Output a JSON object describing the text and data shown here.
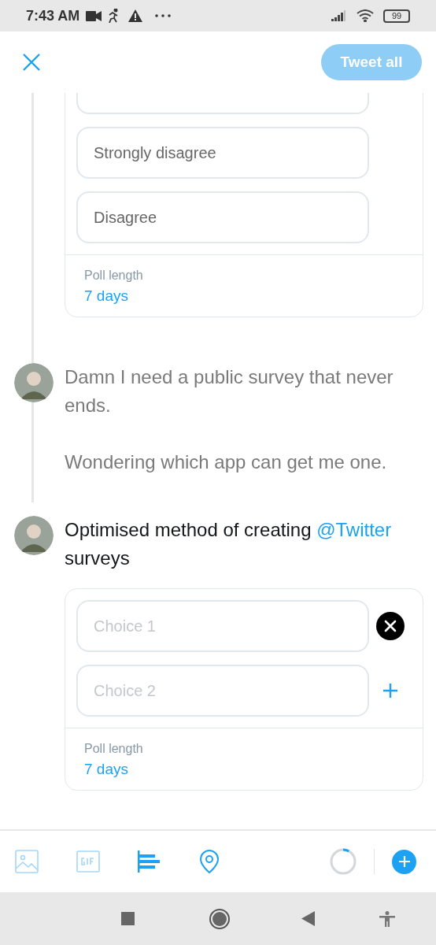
{
  "status_bar": {
    "time": "7:43 AM",
    "battery": "99"
  },
  "header": {
    "tweet_button": {
      "label": "Tweet all",
      "disabled": true
    }
  },
  "thread": [
    {
      "poll": {
        "choices": [
          {
            "kind": "clipped"
          },
          {
            "value": "Strongly disagree"
          },
          {
            "value": "Disagree"
          }
        ],
        "length_label": "Poll length",
        "length": "7 days"
      }
    },
    {
      "active": false,
      "paragraphs": [
        [
          {
            "text": "Damn I need a public survey that never ends."
          }
        ],
        [
          {
            "text": "Wondering which app can get me one."
          }
        ]
      ]
    },
    {
      "active": true,
      "paragraphs": [
        [
          {
            "text": "Optimised method of creating "
          },
          {
            "text": "@Twitter",
            "kind": "mention"
          },
          {
            "text": " surveys"
          }
        ]
      ],
      "poll": {
        "removable": true,
        "can_add_choice": true,
        "choices": [
          {
            "placeholder": "Choice 1"
          },
          {
            "placeholder": "Choice 2"
          }
        ],
        "length_label": "Poll length",
        "length": "7 days"
      }
    }
  ],
  "toolbar": {
    "items": [
      {
        "kind": "image",
        "disabled": true
      },
      {
        "kind": "gif",
        "disabled": true
      },
      {
        "kind": "poll",
        "disabled": false
      },
      {
        "kind": "location",
        "disabled": false
      }
    ],
    "progress": {
      "level": 0.08
    }
  }
}
